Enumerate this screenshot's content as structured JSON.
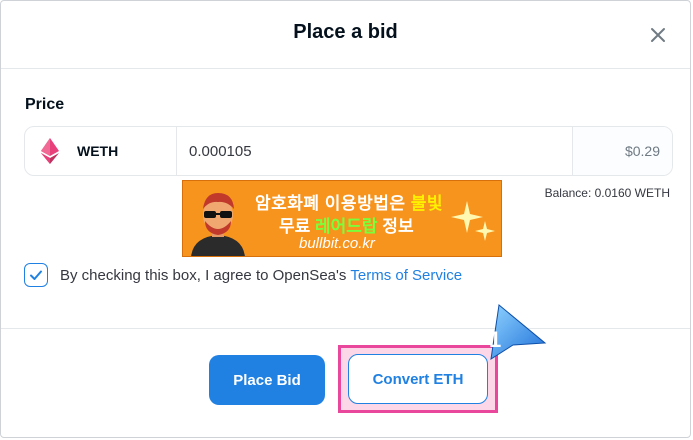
{
  "modal": {
    "title": "Place a bid"
  },
  "price": {
    "label": "Price",
    "token": "WETH",
    "amount": "0.000105",
    "usd_value": "$0.29",
    "balance": "Balance: 0.0160 WETH"
  },
  "ad": {
    "line1_a": "암호화폐 이용방법은 ",
    "line1_b": "불빛",
    "line2_a": "무료 ",
    "line2_b": "레어드랍",
    "line2_c": " 정보",
    "line3": "bullbit.co.kr"
  },
  "agreement": {
    "checked": true,
    "text": "By checking this box, I agree to OpenSea's",
    "link": "Terms of Service"
  },
  "actions": {
    "place_bid": "Place Bid",
    "convert_eth": "Convert ETH"
  },
  "annotation": {
    "step": "1"
  },
  "colors": {
    "accent": "#2081e2",
    "highlight_border": "#e8479c",
    "ad_background": "#f7941d",
    "eth_icon": "#e8407a"
  }
}
